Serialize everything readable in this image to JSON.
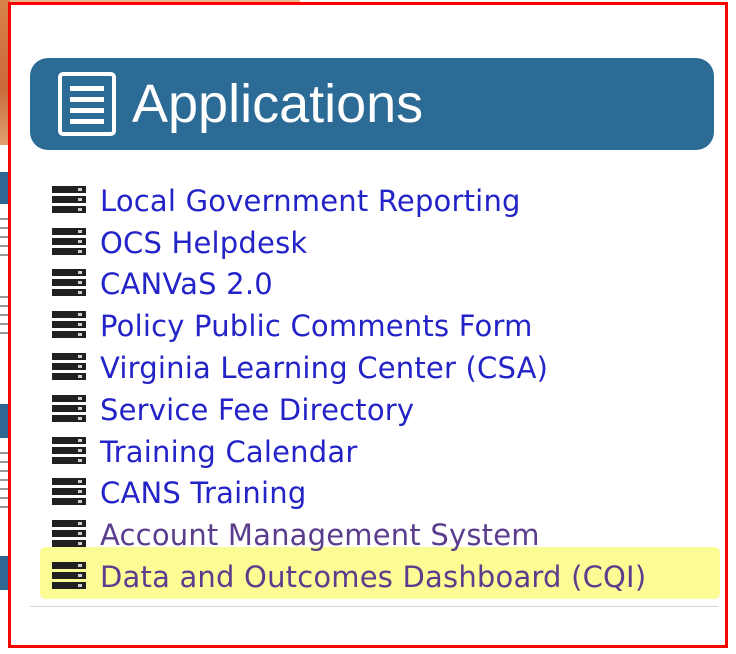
{
  "panel": {
    "title": "Applications",
    "icon": "list-document-icon"
  },
  "applications": [
    {
      "label": "Local Government Reporting",
      "icon": "server-icon"
    },
    {
      "label": "OCS Helpdesk",
      "icon": "server-icon"
    },
    {
      "label": "CANVaS 2.0",
      "icon": "server-icon"
    },
    {
      "label": "Policy Public Comments Form",
      "icon": "server-icon"
    },
    {
      "label": "Virginia Learning Center (CSA)",
      "icon": "server-icon"
    },
    {
      "label": "Service Fee Directory",
      "icon": "server-icon"
    },
    {
      "label": "Training Calendar",
      "icon": "server-icon"
    },
    {
      "label": "CANS Training",
      "icon": "server-icon"
    },
    {
      "label": "Account Management System",
      "icon": "server-icon"
    },
    {
      "label": "Data and Outcomes Dashboard (CQI)",
      "icon": "server-icon"
    }
  ],
  "colors": {
    "header_bg": "#2c6b96",
    "link": "#2323c8",
    "visited_link": "#5a3d8c",
    "highlight": "#fbfb7e",
    "frame": "#ff0000"
  }
}
